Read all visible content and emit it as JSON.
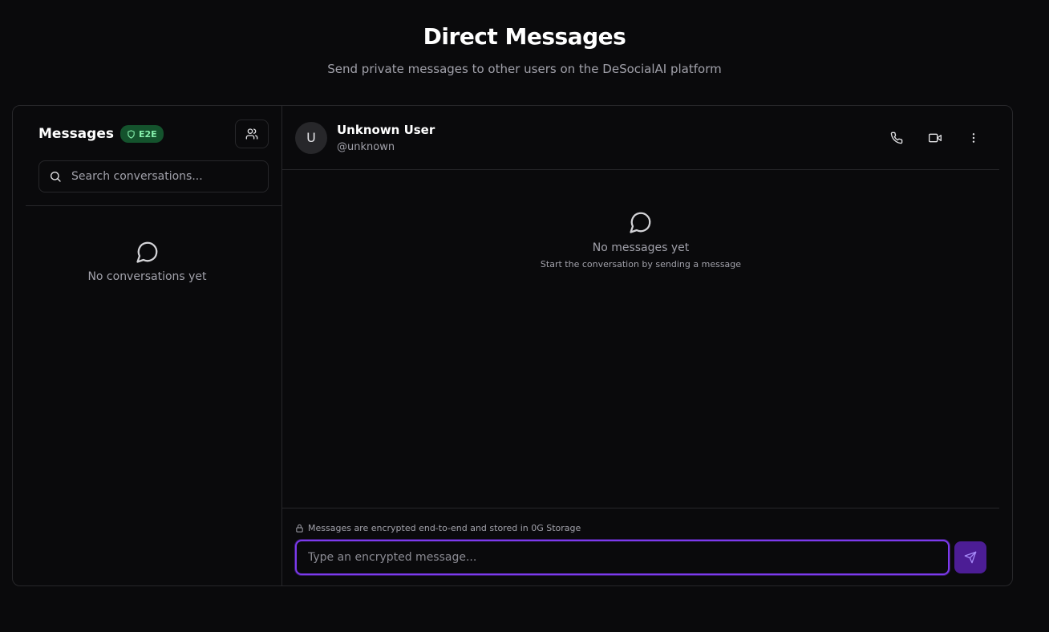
{
  "page": {
    "title": "Direct Messages",
    "subtitle": "Send private messages to other users on the DeSocialAI platform"
  },
  "sidebar": {
    "title": "Messages",
    "badge": "E2E",
    "search_placeholder": "Search conversations...",
    "empty_text": "No conversations yet"
  },
  "chat": {
    "avatar_initial": "U",
    "user_name": "Unknown User",
    "user_handle": "@unknown",
    "empty_title": "No messages yet",
    "empty_subtitle": "Start the conversation by sending a message",
    "encryption_note": "Messages are encrypted end-to-end and stored in 0G Storage",
    "input_placeholder": "Type an encrypted message..."
  },
  "icons": {
    "badge": "shield-icon",
    "new_chat": "users-icon",
    "search": "search-icon",
    "empty": "message-circle-icon",
    "call": "phone-icon",
    "video": "video-icon",
    "more": "more-vertical-icon",
    "lock": "lock-icon",
    "send": "send-icon"
  },
  "colors": {
    "accent": "#7c3aed",
    "badge_bg": "#14532d",
    "badge_text": "#86efac",
    "background": "#0a0a0c"
  }
}
